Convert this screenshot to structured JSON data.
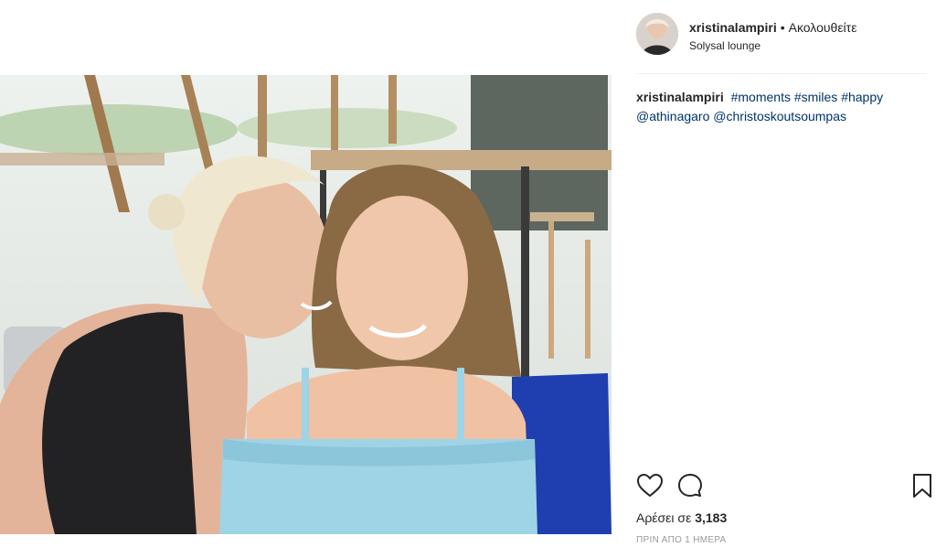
{
  "post": {
    "username": "xristinalampiri",
    "separator": "•",
    "follow_status": "Ακολουθείτε",
    "location": "Solysal lounge",
    "caption": {
      "username": "xristinalampiri",
      "tags": [
        "#moments",
        "#smiles",
        "#happy"
      ],
      "mentions": [
        "@athinagaro",
        "@christoskoutsoumpas"
      ]
    },
    "likes_label": "Αρέσει σε",
    "likes_count": "3,183",
    "timestamp": "ΠΡΙΝ ΑΠΟ 1 ΗΜΕΡΑ"
  },
  "icons": {
    "like": "heart-icon",
    "comment": "comment-icon",
    "save": "bookmark-icon"
  },
  "colors": {
    "link": "#003569",
    "text": "#262626",
    "muted": "#999999",
    "shirt": "#9fd3e6"
  }
}
